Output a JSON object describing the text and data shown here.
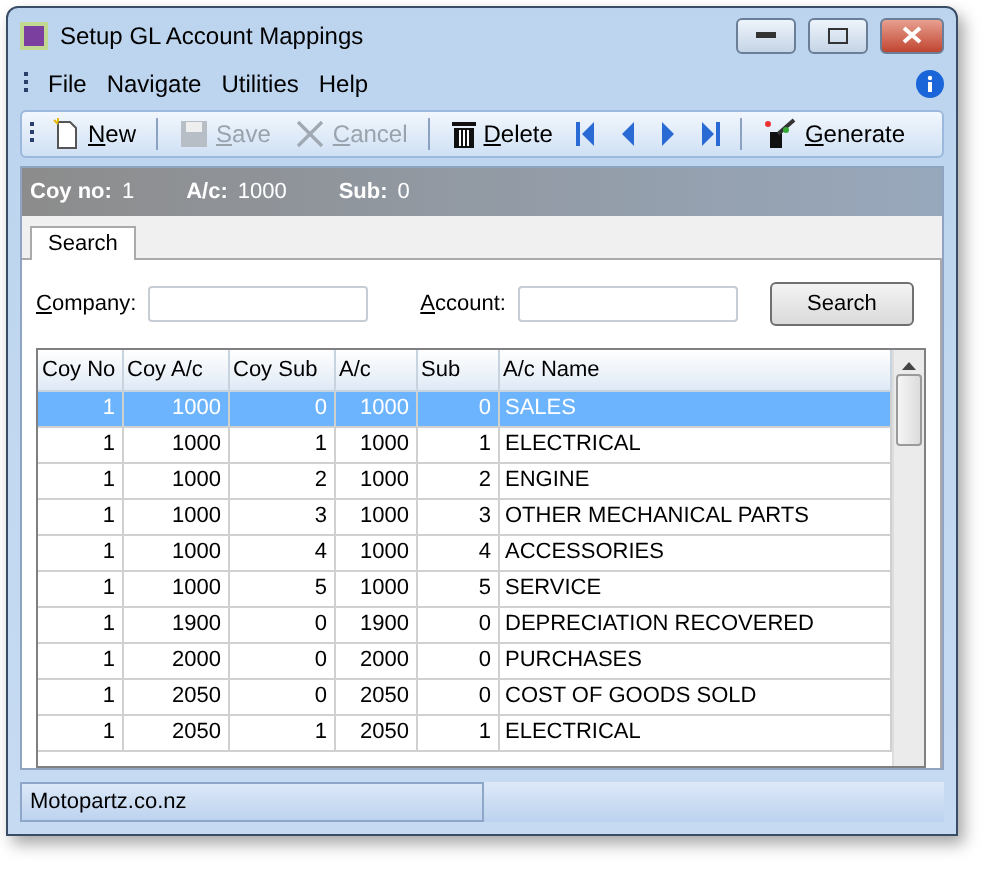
{
  "window": {
    "title": "Setup GL Account Mappings"
  },
  "menu": [
    "File",
    "Navigate",
    "Utilities",
    "Help"
  ],
  "toolbar": [
    {
      "label": "New",
      "disabled": false
    },
    {
      "label": "Save",
      "disabled": true
    },
    {
      "label": "Cancel",
      "disabled": true
    },
    {
      "label": "Delete",
      "disabled": false
    },
    {
      "label": "Generate",
      "disabled": false
    }
  ],
  "info_bar": [
    {
      "label": "Coy no:",
      "value": "1"
    },
    {
      "label": "A/c:",
      "value": "1000"
    },
    {
      "label": "Sub:",
      "value": "0"
    }
  ],
  "tabs": [
    {
      "label": "Search",
      "selected": true
    }
  ],
  "search": {
    "company_label": "Company:",
    "account_label": "Account:",
    "button": "Search"
  },
  "table": {
    "columns": [
      "Coy No",
      "Coy A/c",
      "Coy Sub",
      "A/c",
      "Sub",
      "A/c Name"
    ],
    "rows": [
      {
        "cells": [
          "1",
          "1000",
          "0",
          "1000",
          "0",
          "SALES"
        ],
        "selected": true
      },
      {
        "cells": [
          "1",
          "1000",
          "1",
          "1000",
          "1",
          "ELECTRICAL"
        ],
        "selected": false
      },
      {
        "cells": [
          "1",
          "1000",
          "2",
          "1000",
          "2",
          "ENGINE"
        ],
        "selected": false
      },
      {
        "cells": [
          "1",
          "1000",
          "3",
          "1000",
          "3",
          "OTHER MECHANICAL PARTS"
        ],
        "selected": false
      },
      {
        "cells": [
          "1",
          "1000",
          "4",
          "1000",
          "4",
          "ACCESSORIES"
        ],
        "selected": false
      },
      {
        "cells": [
          "1",
          "1000",
          "5",
          "1000",
          "5",
          "SERVICE"
        ],
        "selected": false
      },
      {
        "cells": [
          "1",
          "1900",
          "0",
          "1900",
          "0",
          "DEPRECIATION RECOVERED"
        ],
        "selected": false
      },
      {
        "cells": [
          "1",
          "2000",
          "0",
          "2000",
          "0",
          "PURCHASES"
        ],
        "selected": false
      },
      {
        "cells": [
          "1",
          "2050",
          "0",
          "2050",
          "0",
          "COST OF GOODS SOLD"
        ],
        "selected": false
      },
      {
        "cells": [
          "1",
          "2050",
          "1",
          "2050",
          "1",
          "ELECTRICAL"
        ],
        "selected": false
      }
    ]
  },
  "status_bar": "Motopartz.co.nz"
}
